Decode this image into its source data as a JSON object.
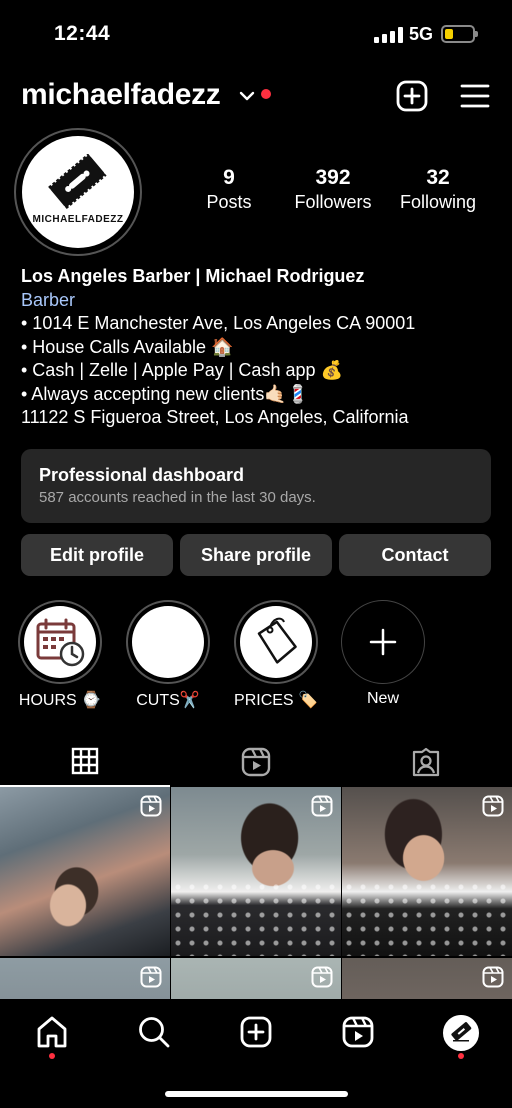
{
  "status_bar": {
    "time": "12:44",
    "network": "5G",
    "battery_color": "#f5d000"
  },
  "header": {
    "username": "michaelfadezz"
  },
  "avatar": {
    "logo_text": "MICHAELFADEZZ"
  },
  "stats": [
    {
      "value": "9",
      "label": "Posts"
    },
    {
      "value": "392",
      "label": "Followers"
    },
    {
      "value": "32",
      "label": "Following"
    }
  ],
  "bio": {
    "name": "Los Angeles Barber | Michael Rodriguez",
    "category": "Barber",
    "lines": [
      "• 1014 E Manchester Ave, Los Angeles CA 90001",
      "• House Calls Available 🏠",
      "• Cash | Zelle | Apple Pay | Cash app 💰",
      "• Always accepting new clients🤙🏻💈",
      "11122 S Figueroa Street, Los Angeles, California"
    ]
  },
  "dashboard": {
    "title": "Professional dashboard",
    "subtitle": "587 accounts reached in the last 30 days."
  },
  "buttons": {
    "edit": "Edit profile",
    "share": "Share profile",
    "contact": "Contact"
  },
  "highlights": [
    {
      "label": "HOURS ⌚"
    },
    {
      "label": "CUTS✂️"
    },
    {
      "label": "PRICES 🏷️"
    },
    {
      "label": "New"
    }
  ],
  "colors": {
    "accent_link": "#a8c7fa",
    "notification": "#ff3040",
    "button_bg": "#363636",
    "card_bg": "#262626"
  }
}
